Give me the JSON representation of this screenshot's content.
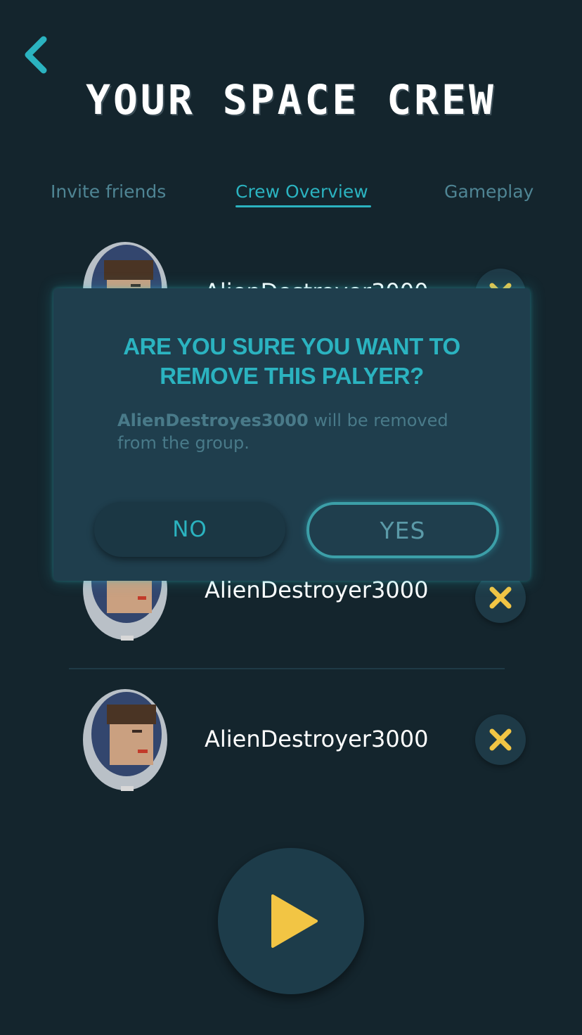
{
  "header": {
    "back_icon": "chevron-left-icon",
    "title": "YOUR SPACE CREW"
  },
  "tabs": [
    {
      "label": "Invite friends",
      "active": false
    },
    {
      "label": "Crew Overview",
      "active": true
    },
    {
      "label": "Gameplay",
      "active": false
    }
  ],
  "crew": [
    {
      "name": "AlienDestroyer3000"
    },
    {
      "name": "AlienDestroyer3000"
    },
    {
      "name": "AlienDestroyer3000"
    }
  ],
  "modal": {
    "title_line1": "ARE YOU SURE YOU WANT TO",
    "title_line2": "REMOVE THIS PALYER?",
    "player_name": "AlienDestroyes3000",
    "message_rest": " will be removed from the group.",
    "no_label": "NO",
    "yes_label": "YES"
  },
  "play_icon": "play-icon",
  "colors": {
    "background": "#14252d",
    "accent": "#2bb3c0",
    "remove_x": "#f2c544",
    "play": "#f2c544"
  }
}
